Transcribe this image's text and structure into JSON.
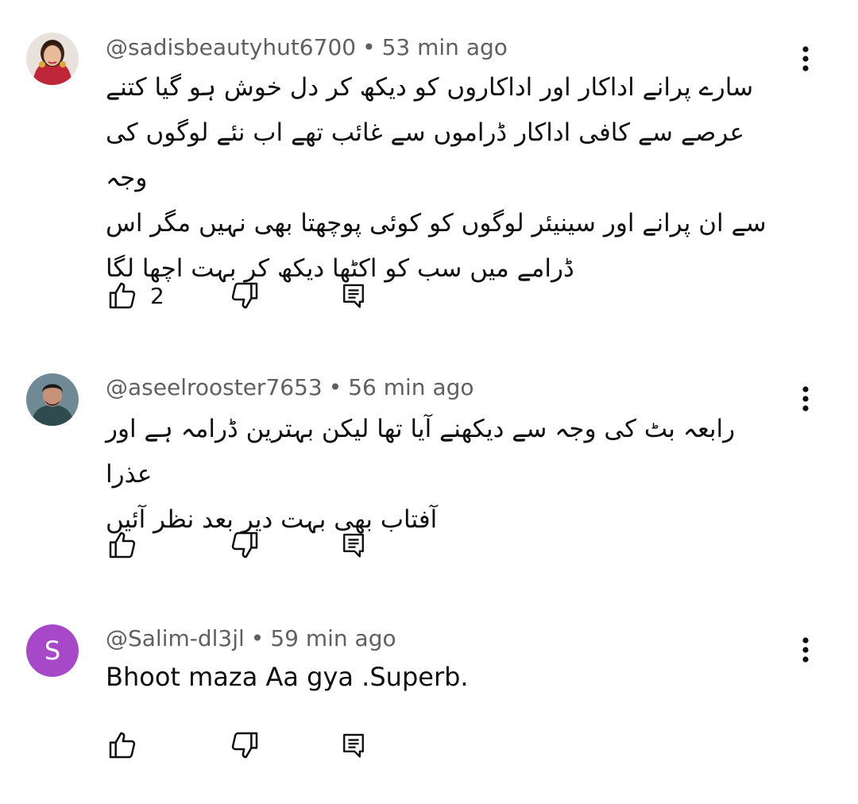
{
  "comments": [
    {
      "handle": "@sadisbeautyhut6700",
      "separator": "•",
      "time": "53 min ago",
      "text_lines": [
        "سارے پرانے اداکار اور اداکاروں کو دیکھ کر دل خوش ہو گیا کتنے",
        "عرصے سے کافی اداکار ڈراموں سے غائب تھے اب نئے لوگوں کی وجہ",
        "سے ان پرانے اور سینیئر لوگوں کو کوئی پوچھتا بھی نہیں مگر اس",
        "ڈرامے میں سب کو اکٹھا دیکھ کر بہت اچھا لگا"
      ],
      "likes": "2",
      "avatar_icon": "profile-photo-woman"
    },
    {
      "handle": "@aseelrooster7653",
      "separator": "•",
      "time": "56 min ago",
      "text_lines": [
        "رابعہ بٹ کی وجہ سے دیکھنے آیا تھا لیکن بہترین ڈرامہ ہے اور عذرا",
        "آفتاب بھی بہت دیر بعد نظر آئیں"
      ],
      "likes": "",
      "avatar_icon": "profile-photo-man"
    },
    {
      "handle": "@Salim-dl3jl",
      "separator": "•",
      "time": "59 min ago",
      "text_lines": [
        "Bhoot maza Aa gya .Superb."
      ],
      "likes": "",
      "avatar_letter": "S",
      "avatar_color": "#a748c9"
    }
  ],
  "icons": {
    "like": "thumb-up-icon",
    "dislike": "thumb-down-icon",
    "reply": "reply-comment-icon",
    "menu": "more-vertical-icon"
  },
  "colors": {
    "meta_text": "#606060",
    "body_text": "#0f0f0f",
    "background": "#ffffff"
  }
}
